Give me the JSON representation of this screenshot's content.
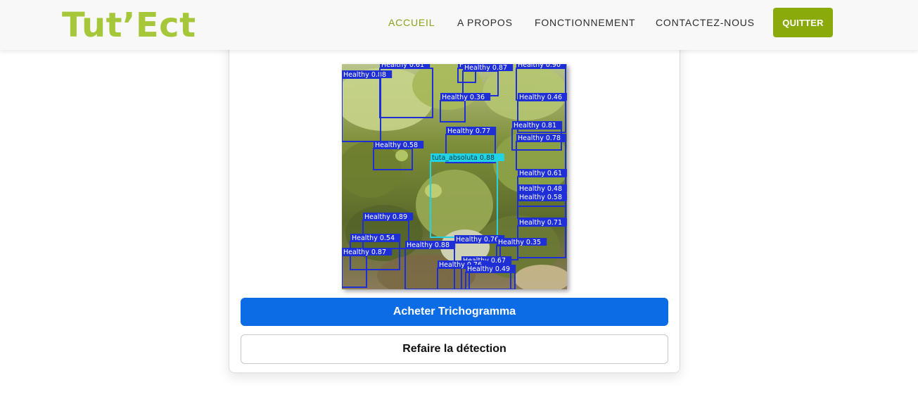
{
  "brand": {
    "logo_text": "Tut’Ect",
    "logo_color": "#a7c73a"
  },
  "nav": {
    "items": [
      {
        "label": "ACCUEIL",
        "active": true
      },
      {
        "label": "A PROPOS",
        "active": false
      },
      {
        "label": "FONCTIONNEMENT",
        "active": false
      },
      {
        "label": "CONTACTEZ-NOUS",
        "active": false
      }
    ],
    "quit_label": "QUITTER",
    "active_color": "#8aa31a",
    "quit_color": "#8aaa0b"
  },
  "result": {
    "detections": [
      {
        "label": "Healthy 0.88",
        "class": "Healthy"
      },
      {
        "label": "Healthy 0.61",
        "class": "Healthy"
      },
      {
        "label": "Healthy 0.42",
        "class": "Healthy"
      },
      {
        "label": "Healthy 0.87",
        "class": "Healthy"
      },
      {
        "label": "Healthy 0.90",
        "class": "Healthy"
      },
      {
        "label": "Healthy 0.36",
        "class": "Healthy"
      },
      {
        "label": "Healthy 0.46",
        "class": "Healthy"
      },
      {
        "label": "Healthy 0.81",
        "class": "Healthy"
      },
      {
        "label": "Healthy 0.77",
        "class": "Healthy"
      },
      {
        "label": "Healthy 0.58",
        "class": "Healthy"
      },
      {
        "label": "Healthy 0.78",
        "class": "Healthy"
      },
      {
        "label": "tuta_absoluta 0.88",
        "class": "tuta_absoluta"
      },
      {
        "label": "Healthy 0.61",
        "class": "Healthy"
      },
      {
        "label": "Healthy 0.48",
        "class": "Healthy"
      },
      {
        "label": "Healthy 0.58",
        "class": "Healthy"
      },
      {
        "label": "Healthy 0.89",
        "class": "Healthy"
      },
      {
        "label": "Healthy 0.71",
        "class": "Healthy"
      },
      {
        "label": "Healthy 0.54",
        "class": "Healthy"
      },
      {
        "label": "Healthy 0.76",
        "class": "Healthy"
      },
      {
        "label": "Healthy 0.35",
        "class": "Healthy"
      },
      {
        "label": "Healthy 0.88",
        "class": "Healthy"
      },
      {
        "label": "Healthy 0.87",
        "class": "Healthy"
      },
      {
        "label": "Healthy 0.67",
        "class": "Healthy"
      },
      {
        "label": "Healthy 0.76",
        "class": "Healthy"
      },
      {
        "label": "Healthy 0.49",
        "class": "Healthy"
      }
    ],
    "healthy_color": "#1e2fd6",
    "pest_color": "#22d3e6"
  },
  "actions": {
    "buy_label": "Acheter Trichogramma",
    "redo_label": "Refaire la détection",
    "buy_color": "#0b6ce6"
  }
}
